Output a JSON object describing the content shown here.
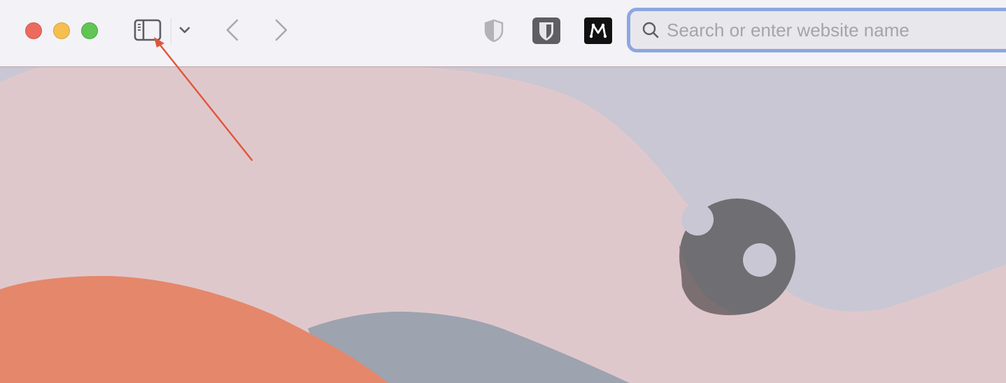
{
  "toolbar": {
    "window_controls": [
      "close",
      "minimize",
      "maximize"
    ],
    "sidebar_toggle": "sidebar-icon",
    "tab_overview_chevron": "chevron-down-icon",
    "back": "chevron-left-icon",
    "forward": "chevron-right-icon",
    "extensions": [
      {
        "name": "privacy-shield",
        "icon": "shield-icon"
      },
      {
        "name": "bitwarden",
        "icon": "bitwarden-shield-icon"
      },
      {
        "name": "medium",
        "icon": "medium-m-icon"
      }
    ]
  },
  "search": {
    "placeholder": "Search or enter website name",
    "value": "",
    "icon": "magnifier-icon"
  },
  "colors": {
    "accent_focus": "#8ea6e2",
    "annotation_arrow": "#e0553a",
    "wallpaper_pink": "#dfc8cc",
    "wallpaper_lavender": "#c9c7d3",
    "wallpaper_orange": "#e5876a",
    "wallpaper_slate": "#9da3af"
  }
}
